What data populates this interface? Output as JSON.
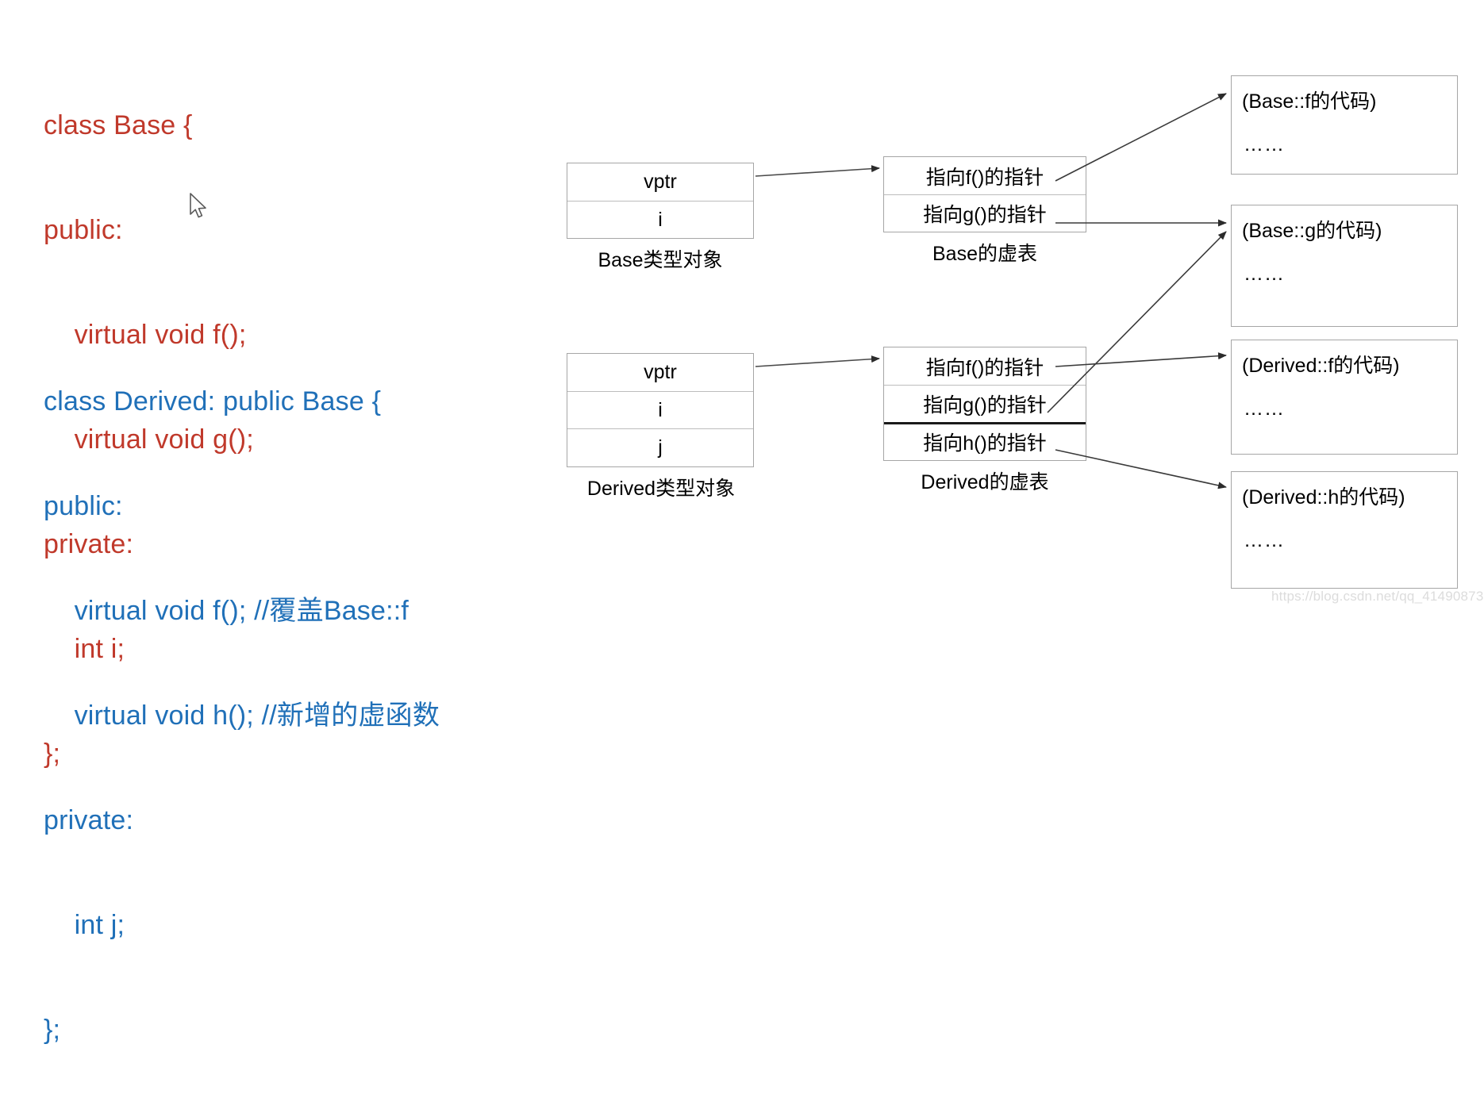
{
  "code_panels": {
    "base": {
      "color": "#c0392b",
      "lines": [
        "class Base {",
        "public:",
        "    virtual void f();",
        "    virtual void g();",
        "private:",
        "    int i;",
        "};"
      ]
    },
    "derived": {
      "color": "#2070b8",
      "lines": [
        "class Derived: public Base {",
        "public:",
        "    virtual void f(); //覆盖Base::f",
        "    virtual void h(); //新增的虚函数",
        "private:",
        "    int j;",
        "};"
      ]
    }
  },
  "objects": {
    "base": {
      "caption": "Base类型对象",
      "rows": [
        "vptr",
        "i"
      ]
    },
    "derived": {
      "caption": "Derived类型对象",
      "rows": [
        "vptr",
        "i",
        "j"
      ]
    }
  },
  "vtables": {
    "base": {
      "caption": "Base的虚表",
      "rows": [
        "指向f()的指针",
        "指向g()的指针"
      ]
    },
    "derived": {
      "caption": "Derived的虚表",
      "rows": [
        "指向f()的指针",
        "指向g()的指针",
        "指向h()的指针"
      ]
    }
  },
  "code_bodies": [
    {
      "title": "(Base::f的代码)",
      "dots": "……"
    },
    {
      "title": "(Base::g的代码)",
      "dots": "……"
    },
    {
      "title": "(Derived::f的代码)",
      "dots": "……"
    },
    {
      "title": "(Derived::h的代码)",
      "dots": "……"
    }
  ],
  "watermark": "https://blog.csdn.net/qq_41490873",
  "colors": {
    "base_code": "#c0392b",
    "derived_code": "#2070b8",
    "box_border": "#a6a6a6",
    "arrow": "#3a3a3a"
  }
}
